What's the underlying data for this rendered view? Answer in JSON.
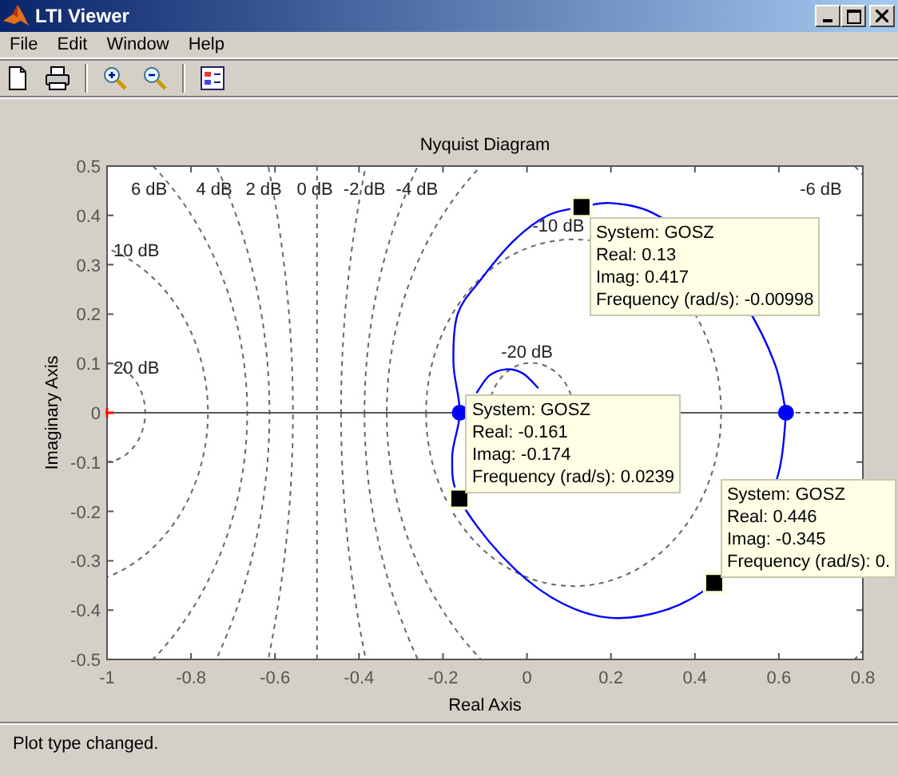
{
  "window": {
    "title": "LTI Viewer"
  },
  "menu": [
    "File",
    "Edit",
    "Window",
    "Help"
  ],
  "plot": {
    "title": "Nyquist Diagram",
    "xlabel": "Real Axis",
    "ylabel": "Imaginary Axis",
    "y_ticks": [
      "0.5",
      "0.4",
      "0.3",
      "0.2",
      "0.1",
      "0",
      "-0.1",
      "-0.2",
      "-0.3",
      "-0.4",
      "-0.5"
    ],
    "x_ticks": [
      "-1",
      "-0.8",
      "-0.6",
      "-0.4",
      "-0.2",
      "0",
      "0.2",
      "0.4",
      "0.6",
      "0.8"
    ],
    "contour_labels": [
      "6 dB",
      "4 dB",
      "2 dB",
      "0 dB",
      "-2 dB",
      "-4 dB",
      "10 dB",
      "20 dB",
      "-10 dB",
      "-20 dB",
      "-6 dB"
    ],
    "data_tips": [
      {
        "lines": [
          "System: GOSZ",
          "Real: 0.13",
          "Imag: 0.417",
          "Frequency (rad/s): -0.00998"
        ]
      },
      {
        "lines": [
          "System: GOSZ",
          "Real: -0.161",
          "Imag: -0.174",
          "Frequency (rad/s): 0.0239"
        ]
      },
      {
        "lines": [
          "System: GOSZ",
          "Real: 0.446",
          "Imag: -0.345",
          "Frequency (rad/s): 0."
        ]
      }
    ]
  },
  "status_bar": "Plot type changed."
}
